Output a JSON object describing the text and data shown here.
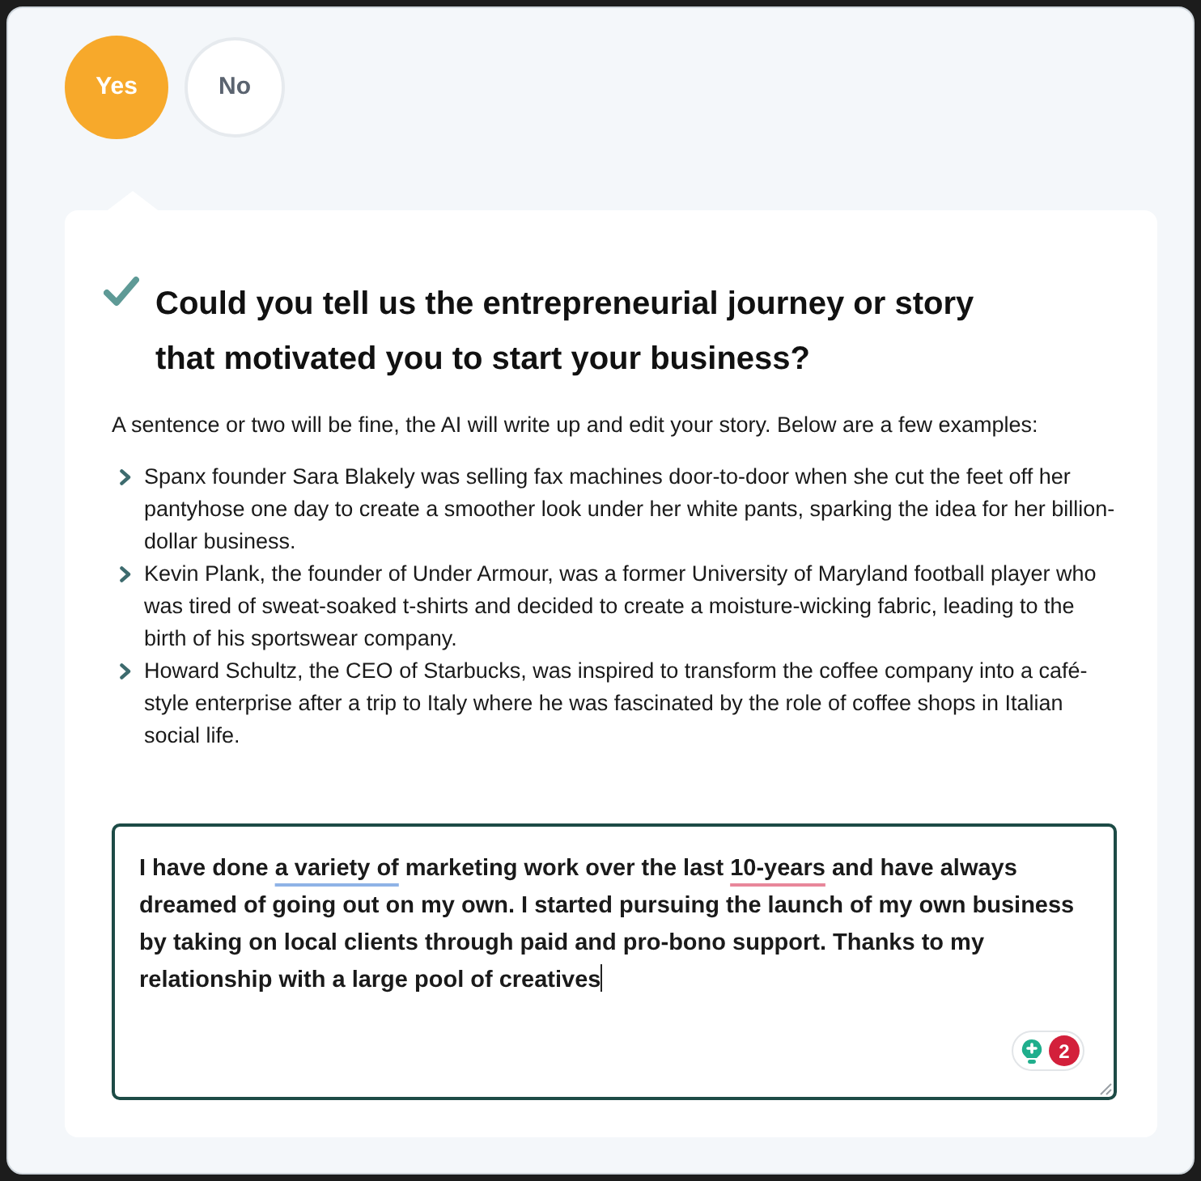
{
  "choices": [
    {
      "label": "Yes",
      "selected": true
    },
    {
      "label": "No",
      "selected": false
    }
  ],
  "question": {
    "completed": true,
    "title": "Could you tell us the entrepreneurial journey or story that motivated you to start your business?",
    "hint": "A sentence or two will be fine, the AI will write up and edit your story. Below are a few examples:",
    "examples": [
      "Spanx founder Sara Blakely was selling fax machines door-to-door when she cut the feet off her pantyhose one day to create a smoother look under her white pants, sparking the idea for her billion-dollar business.",
      "Kevin Plank, the founder of Under Armour, was a former University of Maryland football player who was tired of sweat-soaked t-shirts and decided to create a moisture-wicking fabric, leading to the birth of his sportswear company.",
      "Howard Schultz, the CEO of Starbucks, was inspired to transform the coffee company into a café-style enterprise after a trip to Italy where he was fascinated by the role of coffee shops in Italian social life."
    ]
  },
  "answer": {
    "focused": true,
    "segments": [
      {
        "kind": "plain",
        "text": "I have done "
      },
      {
        "kind": "suggestion",
        "text": "a variety of"
      },
      {
        "kind": "plain",
        "text": " marketing work over the last "
      },
      {
        "kind": "error",
        "text": "10-years"
      },
      {
        "kind": "plain",
        "text": " and have always dreamed of going out on my own. I started pursuing the launch of my own business by taking on local clients through paid and pro-bono support. Thanks to my relationship with a large pool of creatives"
      }
    ],
    "suggestion_count": "2"
  }
}
